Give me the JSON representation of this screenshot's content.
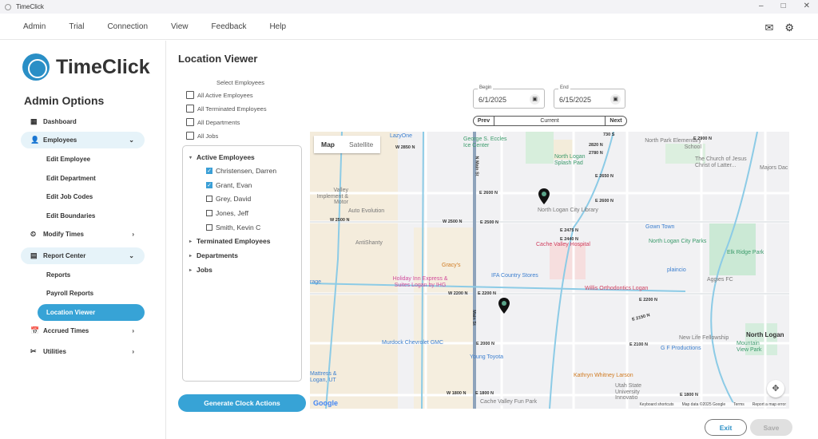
{
  "window": {
    "title": "TimeClick",
    "minimize": "–",
    "maximize": "□",
    "close": "✕"
  },
  "menu": [
    "Admin",
    "Trial",
    "Connection",
    "View",
    "Feedback",
    "Help"
  ],
  "logo": "TimeClick",
  "sidebar": {
    "title": "Admin Options",
    "items": {
      "dashboard": "Dashboard",
      "employees": "Employees",
      "edit_employee": "Edit Employee",
      "edit_department": "Edit Department",
      "edit_job_codes": "Edit Job Codes",
      "edit_boundaries": "Edit Boundaries",
      "modify_times": "Modify Times",
      "report_center": "Report Center",
      "reports": "Reports",
      "payroll_reports": "Payroll Reports",
      "location_viewer": "Location Viewer",
      "accrued_times": "Accrued Times",
      "utilities": "Utilities"
    }
  },
  "page": {
    "title": "Location Viewer",
    "select_header": "Select Employees",
    "all_options": [
      "All Active Employees",
      "All Terminated Employees",
      "All Departments",
      "All Jobs"
    ],
    "tree": {
      "active": "Active Employees",
      "employees": [
        {
          "name": "Christensen, Darren",
          "checked": true
        },
        {
          "name": "Grant, Evan",
          "checked": true
        },
        {
          "name": "Grey, David",
          "checked": false
        },
        {
          "name": "Jones, Jeff",
          "checked": false
        },
        {
          "name": "Smith, Kevin C",
          "checked": false
        }
      ],
      "terminated": "Terminated Employees",
      "departments": "Departments",
      "jobs": "Jobs"
    },
    "generate": "Generate Clock Actions",
    "begin_label": "Begin",
    "begin": "6/1/2025",
    "end_label": "End",
    "end": "6/15/2025",
    "prev": "Prev",
    "current": "Current",
    "next": "Next",
    "exit": "Exit",
    "save": "Save"
  },
  "map": {
    "tab_map": "Map",
    "tab_satellite": "Satellite",
    "google": "Google",
    "attribution": [
      "Keyboard shortcuts",
      "Map data ©2025 Google",
      "Terms",
      "Report a map error"
    ],
    "labels": [
      "LazyOne",
      "George S. Eccles Ice Center",
      "W 2850 N",
      "Valley Implement & Motor",
      "Auto Evolution",
      "W 2500 N",
      "W 2500 N",
      "E 2500 N",
      "E 2600 N",
      "AntiShanty",
      "Gracy's",
      "N Main St",
      "730 S",
      "2820 N",
      "2780 N",
      "North Logan Splash Pad",
      "North Park Elementary School",
      "E 2900 N",
      "The Church of Jesus Christ of Latter...",
      "Majors Dac",
      "E 2650 N",
      "E 2600 N",
      "North Logan City Library",
      "E 2475 N",
      "E 2440 N",
      "Cache Valley Hospital",
      "Gown Town",
      "North Logan City Parks",
      "Elk Ridge Park",
      "plaincio",
      "Holiday Inn Express & Suites Logan by IHG",
      "IFA Country Stores",
      "W 2200 N",
      "E 2200 N",
      "Murdock Chevrolet GMC",
      "E 2000 N",
      "Young Toyota",
      "Mattress & Logan, UT",
      "W 1800 N",
      "E 1800 N",
      "Cache Valley Fun Park",
      "Willis Orthodontics Logan",
      "Aggies FC",
      "E 2200 N",
      "E 2150 N",
      "New Life Fellowship",
      "E 2100 N",
      "G F Productions",
      "North Logan",
      "Mountain View Park",
      "Kathryn Whitney Larson",
      "Utah State University Innovatio",
      "E 1800 N",
      "Main St",
      "rage"
    ]
  }
}
